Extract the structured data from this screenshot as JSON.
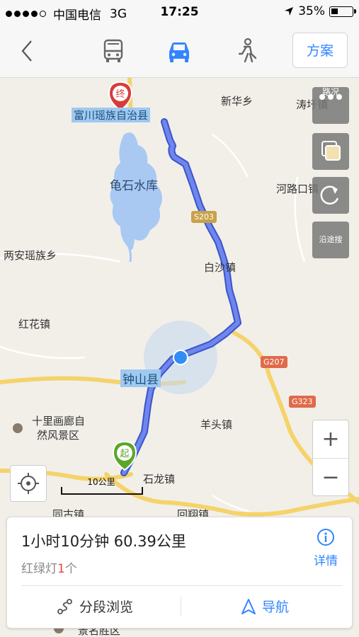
{
  "status": {
    "carrier": "中国电信",
    "network": "3G",
    "time": "17:25",
    "battery": "35%",
    "battery_level": 0.35
  },
  "toolbar": {
    "plan_label": "方案",
    "modes": [
      "bus-icon",
      "car-icon",
      "walk-icon"
    ],
    "active_mode": "car-icon"
  },
  "map": {
    "places": {
      "xinhua": "新华乡",
      "taoxu": "涛圩镇",
      "dest_county": "富川瑶族自治县",
      "reservoir": "龟石水库",
      "helukou": "河路口镇",
      "liangan": "两安瑶族乡",
      "baisha": "白沙镇",
      "honghua": "红花镇",
      "zhongshan": "钟山县",
      "shili_1": "十里画廊自",
      "shili_2": "然风景区",
      "yangtou": "羊头镇",
      "shilong": "石龙镇",
      "tonggu": "同古镇",
      "huixiang": "回翔镇",
      "jingming": "景名胜区"
    },
    "roads": {
      "s203": "S203",
      "g207": "G207",
      "g323": "G323"
    },
    "markers": {
      "end": "终",
      "start": "起"
    },
    "side_buttons": {
      "traffic": "路况",
      "along_search": "沿途搜"
    },
    "zoom": {
      "in": "+",
      "out": "−"
    },
    "scale": "10公里"
  },
  "route": {
    "summary": "1小时10分钟  60.39公里",
    "lights_label": "红绿灯",
    "lights_count": "1",
    "lights_unit": "个",
    "detail_label": "详情",
    "segment_label": "分段浏览",
    "navigate_label": "导航"
  },
  "colors": {
    "accent": "#3385ff",
    "route": "#4a6cf0",
    "highway": "#f5d36b",
    "dest_marker": "#d93b3b",
    "start_marker": "#5aa629"
  }
}
